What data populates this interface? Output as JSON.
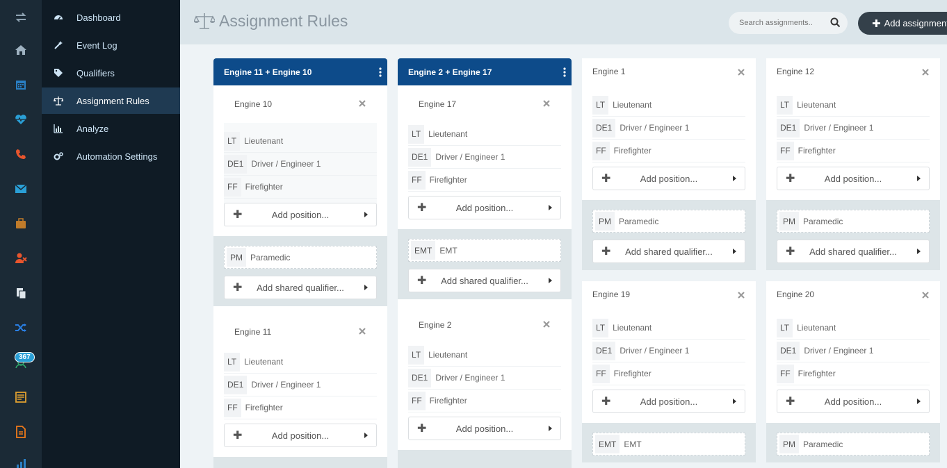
{
  "rail": {
    "badge": "367",
    "icons": [
      "transfer-icon",
      "home-icon",
      "calendar-icon",
      "heartbeat-icon",
      "phone-icon",
      "envelope-icon",
      "briefcase-icon",
      "user-x-icon",
      "documents-icon",
      "shuffle-icon",
      "users-badge-icon",
      "schedule-icon",
      "file-icon",
      "chart-icon"
    ]
  },
  "nav": {
    "items": [
      {
        "label": "Dashboard",
        "icon": "dashboard-icon"
      },
      {
        "label": "Event Log",
        "icon": "wand-icon"
      },
      {
        "label": "Qualifiers",
        "icon": "tags-icon"
      },
      {
        "label": "Assignment Rules",
        "icon": "scale-icon"
      },
      {
        "label": "Analyze",
        "icon": "bar-chart-icon"
      },
      {
        "label": "Automation Settings",
        "icon": "gears-icon"
      }
    ]
  },
  "header": {
    "title": "Assignment Rules",
    "search_placeholder": "Search assignments..",
    "add_label": "Add assignment"
  },
  "groups": [
    {
      "title": "Engine 11 + Engine 10",
      "cards": [
        {
          "name": "Engine 10",
          "positions": [
            [
              "LT",
              "Lieutenant"
            ],
            [
              "DE1",
              "Driver / Engineer 1"
            ],
            [
              "FF",
              "Firefighter"
            ]
          ],
          "add_label": "Add position...",
          "shared": [
            [
              "PM",
              "Paramedic"
            ]
          ],
          "shared_add": "Add shared qualifier..."
        },
        {
          "name": "Engine 11",
          "positions": [
            [
              "LT",
              "Lieutenant"
            ],
            [
              "DE1",
              "Driver / Engineer 1"
            ],
            [
              "FF",
              "Firefighter"
            ]
          ],
          "add_label": "Add position..."
        }
      ]
    },
    {
      "title": "Engine 2 + Engine 17",
      "cards": [
        {
          "name": "Engine 17",
          "positions": [
            [
              "LT",
              "Lieutenant"
            ],
            [
              "DE1",
              "Driver / Engineer 1"
            ],
            [
              "FF",
              "Firefighter"
            ]
          ],
          "add_label": "Add position...",
          "shared": [
            [
              "EMT",
              "EMT"
            ]
          ],
          "shared_add": "Add shared qualifier..."
        },
        {
          "name": "Engine 2",
          "positions": [
            [
              "LT",
              "Lieutenant"
            ],
            [
              "DE1",
              "Driver / Engineer 1"
            ],
            [
              "FF",
              "Firefighter"
            ]
          ],
          "add_label": "Add position..."
        }
      ]
    }
  ],
  "cards": [
    {
      "name": "Engine 1",
      "positions": [
        [
          "LT",
          "Lieutenant"
        ],
        [
          "DE1",
          "Driver / Engineer 1"
        ],
        [
          "FF",
          "Firefighter"
        ]
      ],
      "add_label": "Add position...",
      "shared": [
        [
          "PM",
          "Paramedic"
        ]
      ],
      "shared_add": "Add shared qualifier..."
    },
    {
      "name": "Engine 12",
      "positions": [
        [
          "LT",
          "Lieutenant"
        ],
        [
          "DE1",
          "Driver / Engineer 1"
        ],
        [
          "FF",
          "Firefighter"
        ]
      ],
      "add_label": "Add position...",
      "shared": [
        [
          "PM",
          "Paramedic"
        ]
      ],
      "shared_add": "Add shared qualifier..."
    },
    {
      "name": "Engine 19",
      "positions": [
        [
          "LT",
          "Lieutenant"
        ],
        [
          "DE1",
          "Driver / Engineer 1"
        ],
        [
          "FF",
          "Firefighter"
        ]
      ],
      "add_label": "Add position...",
      "shared": [
        [
          "EMT",
          "EMT"
        ]
      ]
    },
    {
      "name": "Engine 20",
      "positions": [
        [
          "LT",
          "Lieutenant"
        ],
        [
          "DE1",
          "Driver / Engineer 1"
        ],
        [
          "FF",
          "Firefighter"
        ]
      ],
      "add_label": "Add position...",
      "shared": [
        [
          "PM",
          "Paramedic"
        ]
      ]
    }
  ],
  "colors": {
    "rail": "#1b2a36",
    "nav": "#0f1b25",
    "group_header": "#0d4b8a",
    "accent_orange": "#f07a1a",
    "accent_blue": "#2a9fd6"
  }
}
